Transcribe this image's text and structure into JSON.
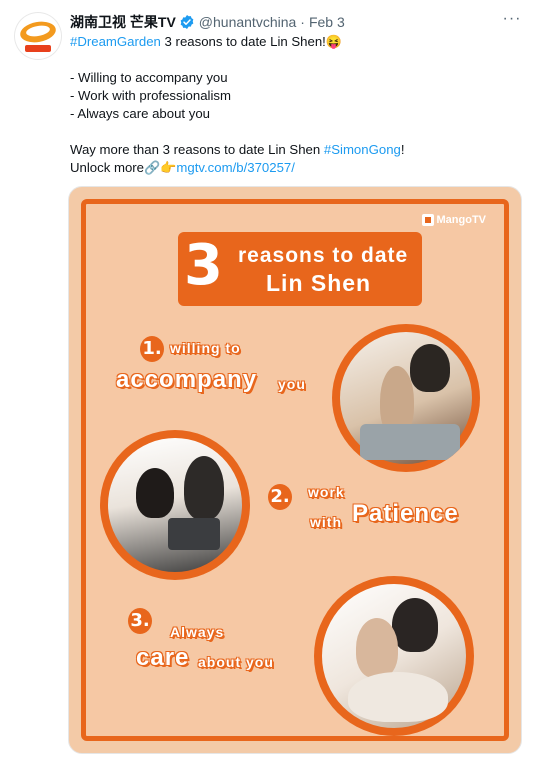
{
  "tweet": {
    "display_name": "湖南卫视 芒果TV",
    "handle": "@hunantvchina",
    "separator": "·",
    "date": "Feb 3",
    "line1_tag": "#DreamGarden",
    "line1_text": " 3 reasons to date Lin Shen!",
    "line1_emoji": "😝",
    "bullets": [
      "- Willing to accompany you",
      "- Work with professionalism",
      "- Always care about you"
    ],
    "line_more_text": "Way more than 3 reasons to date Lin Shen ",
    "line_more_tag": "#SimonGong",
    "line_more_end": "!",
    "unlock_text": "Unlock more",
    "unlock_emojis": "🔗👉",
    "unlock_link": "mgtv.com/b/370257/"
  },
  "image": {
    "brand": "MangoTV",
    "big_number": "3",
    "title_line1": "reasons to date",
    "title_line2": "Lin Shen",
    "items": [
      {
        "num": "1.",
        "small1": "willing to",
        "large": "accompany",
        "small2": "you"
      },
      {
        "num": "2.",
        "small1": "work",
        "small2": "with",
        "large": "Patience"
      },
      {
        "num": "3.",
        "small1": "Always",
        "large": "care",
        "small2": "about you"
      }
    ]
  },
  "colors": {
    "accent": "#e8661c",
    "link": "#1d9bf0",
    "verified": "#1d9bf0"
  }
}
